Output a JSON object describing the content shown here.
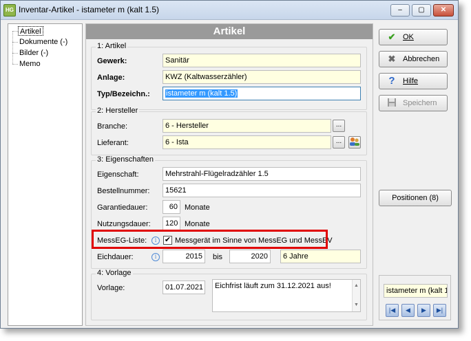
{
  "window": {
    "title": "Inventar-Artikel - istameter m (kalt 1.5)",
    "icon": "HG",
    "controls": {
      "minimize": "‒",
      "maximize": "▢",
      "close": "✕"
    }
  },
  "nav": {
    "items": [
      {
        "label": "Artikel"
      },
      {
        "label": "Dokumente (-)"
      },
      {
        "label": "Bilder (-)"
      },
      {
        "label": "Memo"
      }
    ]
  },
  "main": {
    "header": "Artikel",
    "artikel": {
      "legend": "1: Artikel",
      "gewerk_label": "Gewerk:",
      "gewerk_value": "Sanitär",
      "anlage_label": "Anlage:",
      "anlage_value": "KWZ (Kaltwasserzähler)",
      "typ_label": "Typ/Bezeichn.:",
      "typ_value": "istameter m (kalt 1.5)"
    },
    "hersteller": {
      "legend": "2: Hersteller",
      "branche_label": "Branche:",
      "branche_value": "6 - Hersteller",
      "lieferant_label": "Lieferant:",
      "lieferant_value": "6 - Ista",
      "browse_label": "..."
    },
    "eigenschaften": {
      "legend": "3: Eigenschaften",
      "eigenschaft_label": "Eigenschaft:",
      "eigenschaft_value": "Mehrstrahl-Flügelradzähler 1.5",
      "bestellnummer_label": "Bestellnummer:",
      "bestellnummer_value": "15621",
      "garantie_label": "Garantiedauer:",
      "garantie_value": "60",
      "garantie_unit": "Monate",
      "nutzung_label": "Nutzungsdauer:",
      "nutzung_value": "120",
      "nutzung_unit": "Monate",
      "messeg_label": "MessEG-Liste:",
      "messeg_checkbox_label": "Messgerät im Sinne von MessEG und MessEV",
      "messeg_checked": true,
      "eichdauer_label": "Eichdauer:",
      "eich_from": "2015",
      "eich_bis": "bis",
      "eich_to": "2020",
      "eich_years": "6 Jahre"
    },
    "vorlage": {
      "legend": "4: Vorlage",
      "vorlage_label": "Vorlage:",
      "date_value": "01.07.2021",
      "note": "Eichfrist läuft zum 31.12.2021 aus!"
    }
  },
  "actions": {
    "ok": "OK",
    "cancel": "Abbrechen",
    "help": "Hilfe",
    "save": "Speichern",
    "positions": "Positionen (8)"
  },
  "record_nav": {
    "current": "istameter m (kalt 1.",
    "first": "|◀",
    "prev": "◀",
    "next": "▶",
    "last": "▶|"
  },
  "colors": {
    "header_bg": "#9a9a9a",
    "field_yellow": "#ffffe1",
    "highlight_red": "#e00000",
    "selection_blue": "#3399ff"
  }
}
